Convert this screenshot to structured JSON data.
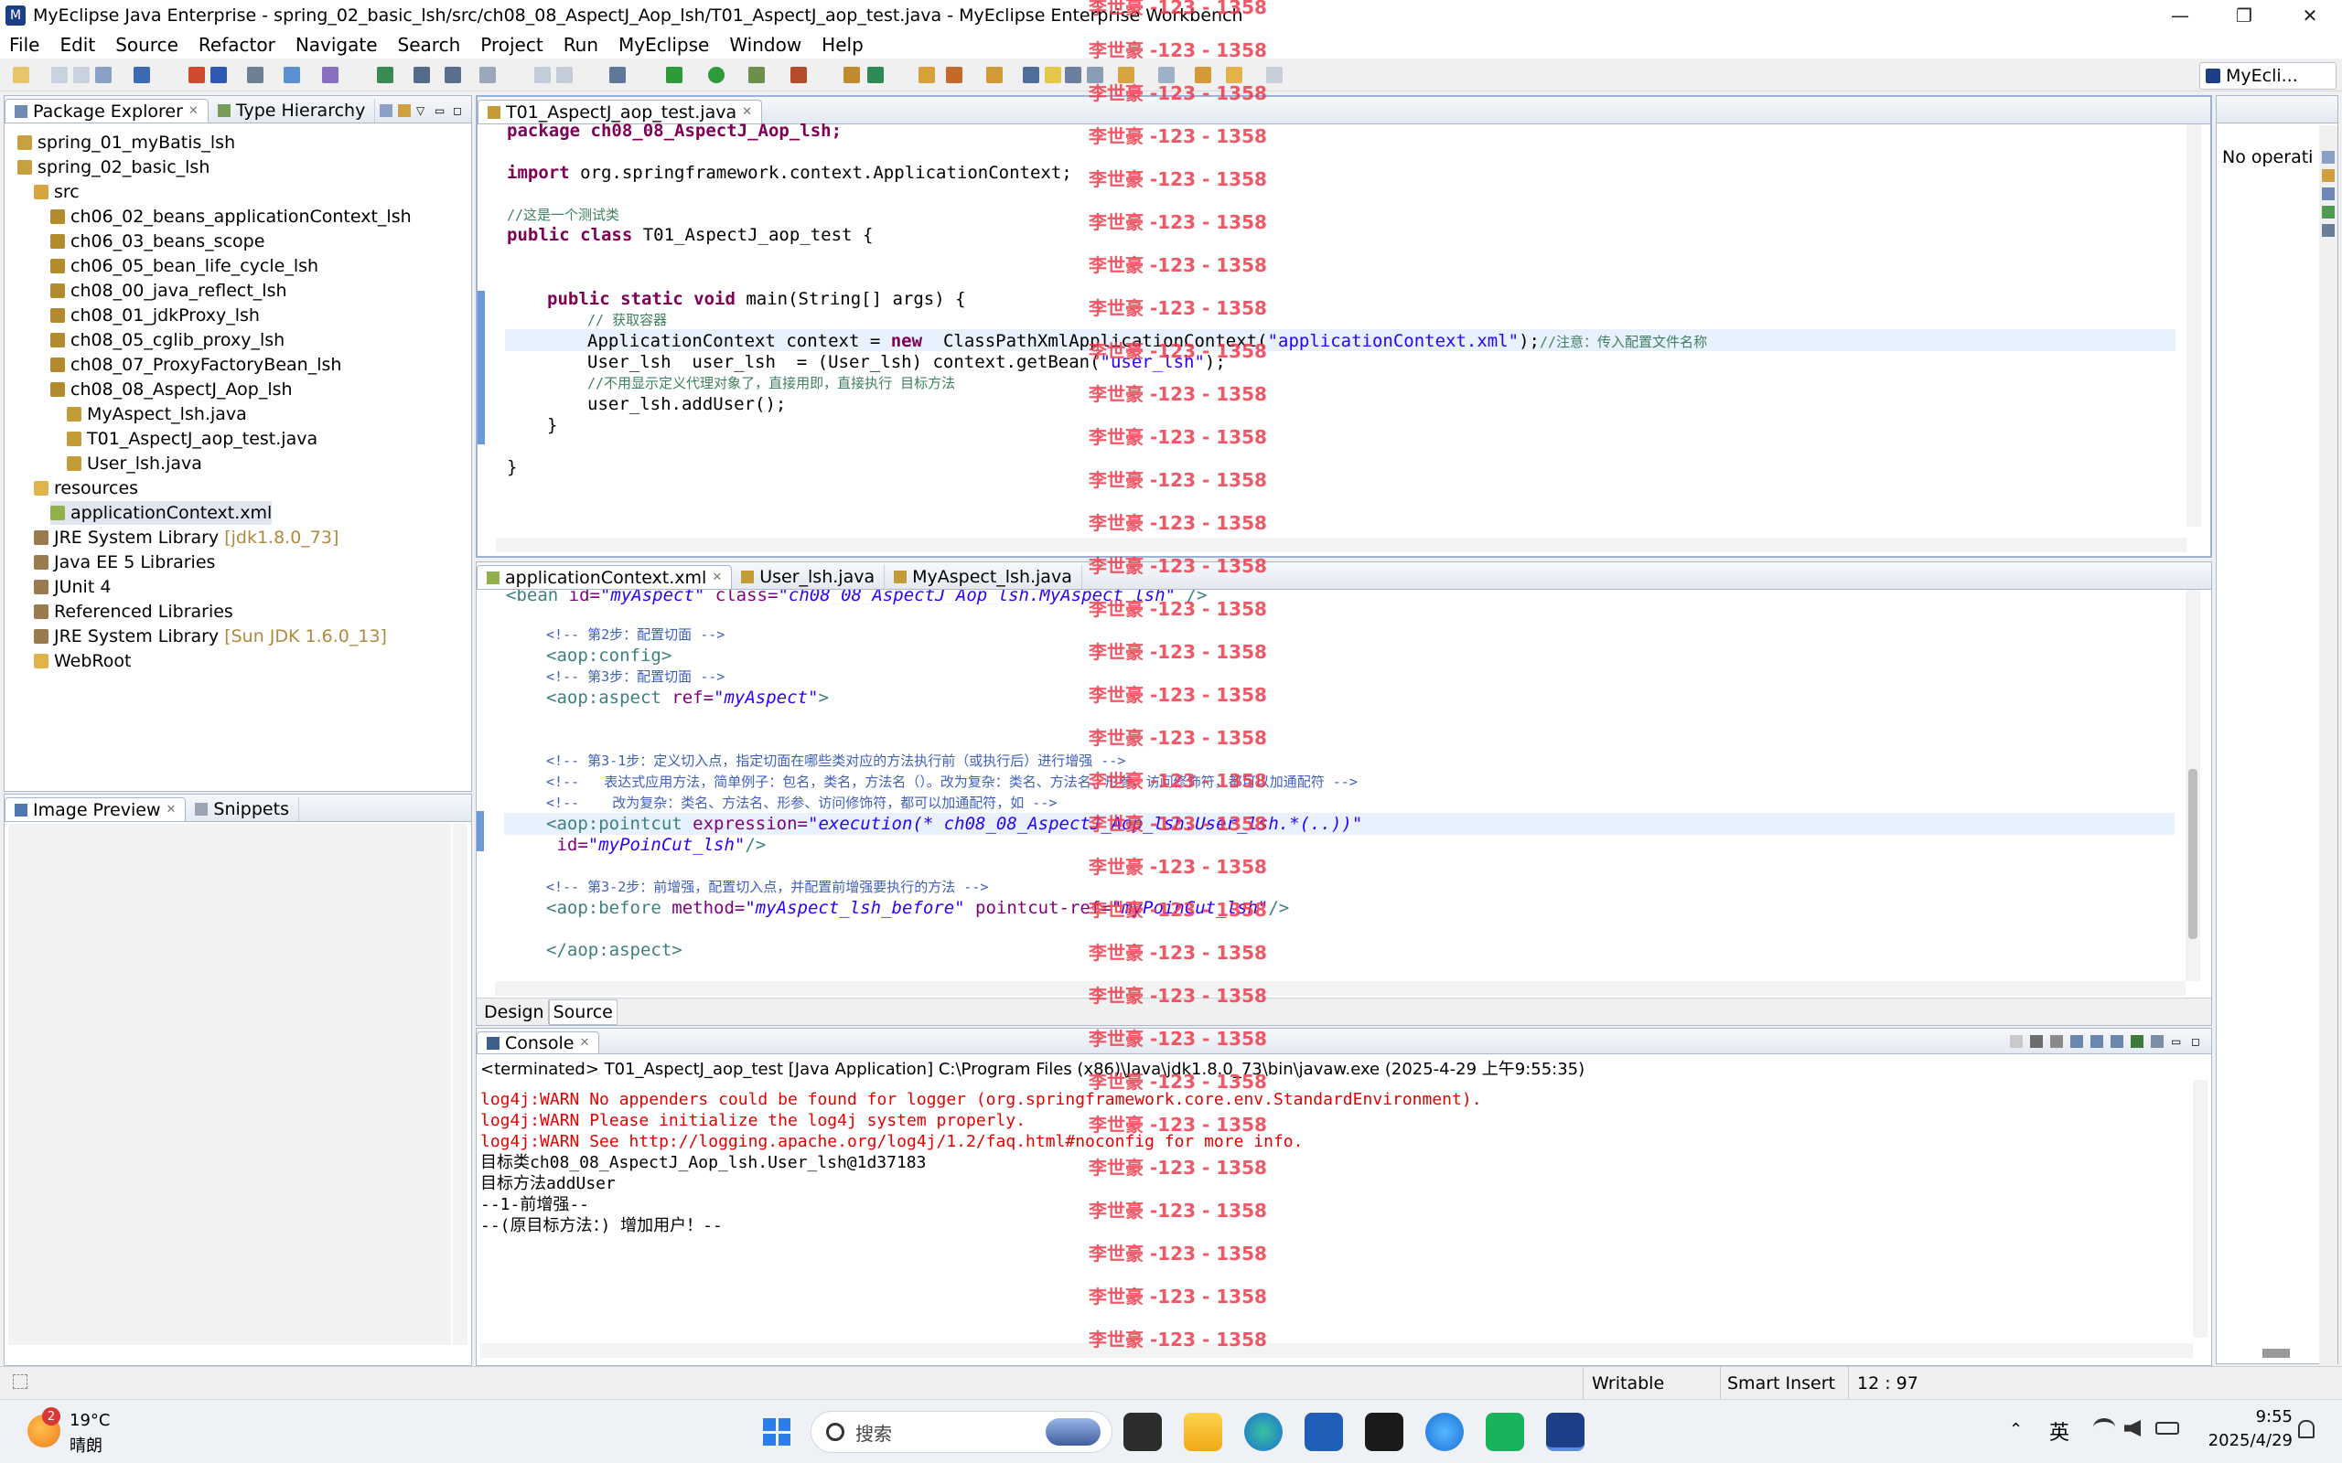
{
  "window": {
    "title": "MyEclipse Java Enterprise - spring_02_basic_lsh/src/ch08_08_AspectJ_Aop_lsh/T01_AspectJ_aop_test.java - MyEclipse Enterprise Workbench",
    "minimize": "—",
    "maximize": "❐",
    "close": "✕"
  },
  "menu": [
    "File",
    "Edit",
    "Source",
    "Refactor",
    "Navigate",
    "Search",
    "Project",
    "Run",
    "MyEclipse",
    "Window",
    "Help"
  ],
  "perspective": {
    "label": "MyEcli...",
    "side_text": "No operati"
  },
  "package_explorer": {
    "tabs": [
      "Package Explorer",
      "Type Hierarchy"
    ],
    "items": [
      {
        "label": "spring_01_myBatis_lsh",
        "level": 0,
        "icon": "project-icon"
      },
      {
        "label": "spring_02_basic_lsh",
        "level": 0,
        "icon": "project-icon"
      },
      {
        "label": "src",
        "level": 1,
        "icon": "source-folder-icon"
      },
      {
        "label": "ch06_02_beans_applicationContext_lsh",
        "level": 2,
        "icon": "package-icon"
      },
      {
        "label": "ch06_03_beans_scope",
        "level": 2,
        "icon": "package-icon"
      },
      {
        "label": "ch06_05_bean_life_cycle_lsh",
        "level": 2,
        "icon": "package-icon"
      },
      {
        "label": "ch08_00_java_reflect_lsh",
        "level": 2,
        "icon": "package-icon"
      },
      {
        "label": "ch08_01_jdkProxy_lsh",
        "level": 2,
        "icon": "package-icon"
      },
      {
        "label": "ch08_05_cglib_proxy_lsh",
        "level": 2,
        "icon": "package-icon"
      },
      {
        "label": "ch08_07_ProxyFactoryBean_lsh",
        "level": 2,
        "icon": "package-icon"
      },
      {
        "label": "ch08_08_AspectJ_Aop_lsh",
        "level": 2,
        "icon": "package-icon"
      },
      {
        "label": "MyAspect_lsh.java",
        "level": 3,
        "icon": "java-file-icon"
      },
      {
        "label": "T01_AspectJ_aop_test.java",
        "level": 3,
        "icon": "java-file-icon"
      },
      {
        "label": "User_lsh.java",
        "level": 3,
        "icon": "java-file-icon"
      },
      {
        "label": "resources",
        "level": 1,
        "icon": "folder-icon"
      },
      {
        "label": "applicationContext.xml",
        "level": 2,
        "icon": "xml-file-icon",
        "selected": true
      },
      {
        "label": "JRE System Library",
        "suffix": "[jdk1.8.0_73]",
        "level": 1,
        "icon": "library-icon"
      },
      {
        "label": "Java EE 5 Libraries",
        "level": 1,
        "icon": "library-icon"
      },
      {
        "label": "JUnit 4",
        "level": 1,
        "icon": "library-icon"
      },
      {
        "label": "Referenced Libraries",
        "level": 1,
        "icon": "library-icon"
      },
      {
        "label": "JRE System Library",
        "suffix": "[Sun JDK 1.6.0_13]",
        "level": 1,
        "icon": "library-icon"
      },
      {
        "label": "WebRoot",
        "level": 1,
        "icon": "folder-icon"
      }
    ]
  },
  "lower_left": {
    "tabs": [
      "Image Preview",
      "Snippets"
    ]
  },
  "java_editor": {
    "tab": "T01_AspectJ_aop_test.java",
    "lines": {
      "l1": "package ch08_08_AspectJ_Aop_lsh;",
      "l2_kw": "import",
      "l2": " org.springframework.context.ApplicationContext;",
      "l3": "//这是一个测试类",
      "l4_kw": "public class",
      "l4": " T01_AspectJ_aop_test {",
      "l5_kw": "public static void",
      "l5": " main(String[] args) {",
      "l6": "// 获取容器",
      "l7a": "ApplicationContext context = ",
      "l7_kw": "new",
      "l7b": "  ClassPathXmlApplicationContext(",
      "l7_str": "\"applicationContext.xml\"",
      "l7c": ");",
      "l7_cm": "//注意：传入配置文件名称",
      "l8a": "User_lsh  user_lsh  = (User_lsh) context.getBean(",
      "l8_str": "\"user_lsh\"",
      "l8b": ");",
      "l9": "//不用显示定义代理对象了，直接用即，直接执行 目标方法",
      "l10": "user_lsh.addUser();",
      "l11": "}",
      "l12": "}"
    }
  },
  "xml_editor": {
    "tabs": [
      "applicationContext.xml",
      "User_lsh.java",
      "MyAspect_lsh.java"
    ],
    "bottom_tabs": [
      "Design",
      "Source"
    ],
    "lines": {
      "x0a": "<bean ",
      "x0b": "id=",
      "x0c": "\"myAspect\"",
      "x0d": " class=",
      "x0e": "\"ch08_08_AspectJ_Aop_lsh.MyAspect_lsh\"",
      "x0f": " />",
      "x1": "<!-- 第2步：配置切面 -->",
      "x2": "<aop:config>",
      "x3": "<!-- 第3步：配置切面 -->",
      "x4a": "<aop:aspect ",
      "x4b": "ref=",
      "x4c": "\"myAspect\"",
      "x4d": ">",
      "x5": "<!-- 第3-1步：定义切入点，指定切面在哪些类对应的方法执行前（或执行后）进行增强 -->",
      "x6": "<!--   表达式应用方法，简单例子：包名，类名，方法名（）。改为复杂：类名、方法名、形参、访问修饰符，都可以加通配符 -->",
      "x7": "<!--    改为复杂：类名、方法名、形参、访问修饰符，都可以加通配符，如 -->",
      "x8a": "<aop:pointcut ",
      "x8b": "expression=",
      "x8c": "\"execution(* ch08_08_AspectJ_Aop_lsh.User_lsh.*(..))\"",
      "x9a": " id=",
      "x9b": "\"myPoinCut_lsh\"",
      "x9c": "/>",
      "x10": "<!-- 第3-2步：前增强，配置切入点，并配置前增强要执行的方法 -->",
      "x11a": "<aop:before ",
      "x11b": "method=",
      "x11c": "\"myAspect_lsh_before\"",
      "x11d": " pointcut-ref=",
      "x11e": "\"myPoinCut_lsh\"",
      "x11f": "/>",
      "x12": "</aop:aspect>"
    }
  },
  "console": {
    "tab": "Console",
    "header": "<terminated> T01_AspectJ_aop_test [Java Application] C:\\Program Files (x86)\\Java\\jdk1.8.0_73\\bin\\javaw.exe (2025-4-29 上午9:55:35)",
    "lines": [
      {
        "text": "log4j:WARN No appenders could be found for logger (org.springframework.core.env.StandardEnvironment).",
        "error": true
      },
      {
        "text": "log4j:WARN Please initialize the log4j system properly.",
        "error": true
      },
      {
        "text": "log4j:WARN See http://logging.apache.org/log4j/1.2/faq.html#noconfig for more info.",
        "error": true
      },
      {
        "text": "目标类ch08_08_AspectJ_Aop_lsh.User_lsh@1d37183",
        "error": false
      },
      {
        "text": "目标方法addUser",
        "error": false
      },
      {
        "text": "--1-前增强--",
        "error": false
      },
      {
        "text": "--(原目标方法：) 增加用户！--",
        "error": false
      }
    ]
  },
  "watermark": "李世豪 -123 - 1358",
  "statusbar": {
    "writable": "Writable",
    "insert_mode": "Smart Insert",
    "position": "12 : 97"
  },
  "taskbar": {
    "weather_temp": "19°C",
    "weather_desc": "晴朗",
    "weather_badge": "2",
    "search_placeholder": "搜索",
    "ime": "英",
    "time": "9:55",
    "date": "2025/4/29"
  }
}
